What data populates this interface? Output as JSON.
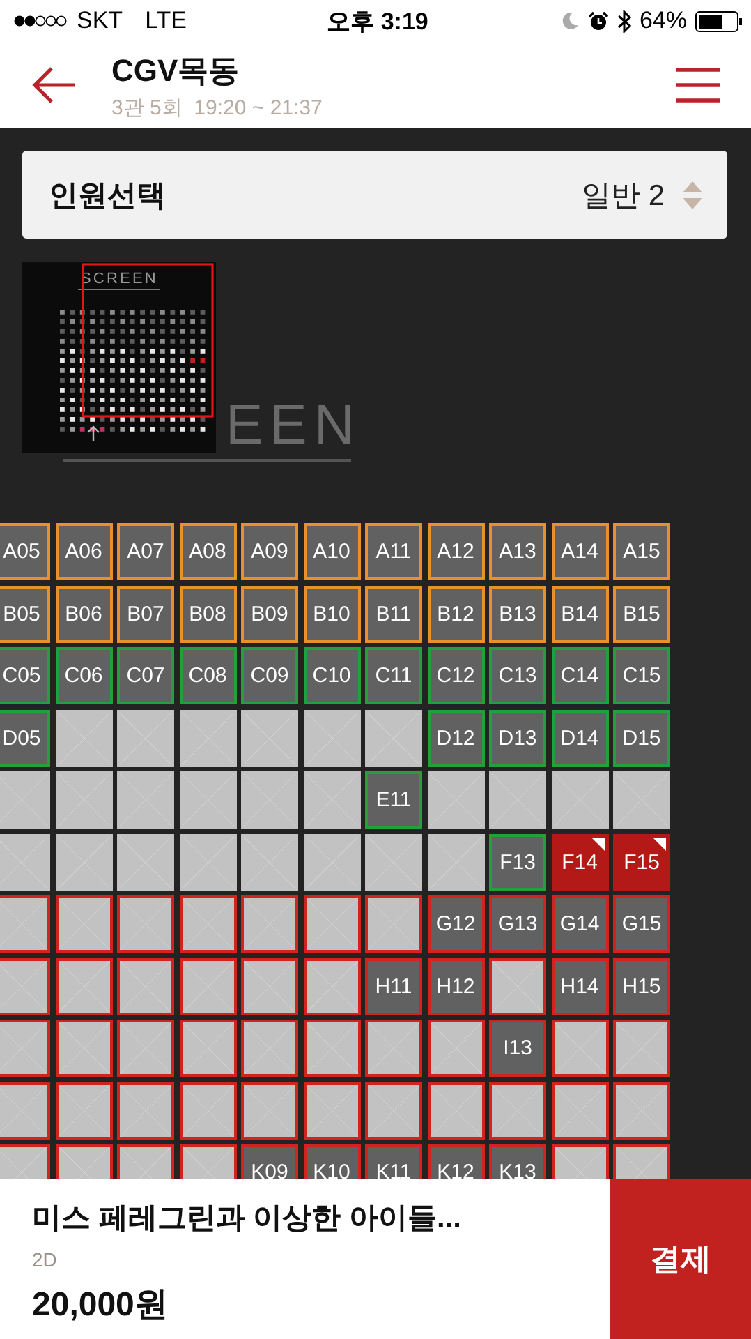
{
  "status_bar": {
    "carrier": "SKT",
    "network": "LTE",
    "time": "오후 3:19",
    "battery": "64%"
  },
  "header": {
    "title": "CGV목동",
    "subtitle": "3관 5회  19:20 ~ 21:37"
  },
  "people_selector": {
    "label": "인원선택",
    "value": "일반 2"
  },
  "screen": {
    "minimap_label": "SCREEN",
    "label": "EEN"
  },
  "seat_rows": [
    {
      "color": "#e8912a",
      "sold_outlined": false,
      "seats": [
        {
          "label": "A05",
          "sold": false,
          "selected": false
        },
        {
          "label": "A06",
          "sold": false,
          "selected": false
        },
        {
          "label": "A07",
          "sold": false,
          "selected": false
        },
        {
          "label": "A08",
          "sold": false,
          "selected": false
        },
        {
          "label": "A09",
          "sold": false,
          "selected": false
        },
        {
          "label": "A10",
          "sold": false,
          "selected": false
        },
        {
          "label": "A11",
          "sold": false,
          "selected": false
        },
        {
          "label": "A12",
          "sold": false,
          "selected": false
        },
        {
          "label": "A13",
          "sold": false,
          "selected": false
        },
        {
          "label": "A14",
          "sold": false,
          "selected": false
        },
        {
          "label": "A15",
          "sold": false,
          "selected": false
        }
      ]
    },
    {
      "color": "#e8912a",
      "sold_outlined": false,
      "seats": [
        {
          "label": "B05",
          "sold": false,
          "selected": false
        },
        {
          "label": "B06",
          "sold": false,
          "selected": false
        },
        {
          "label": "B07",
          "sold": false,
          "selected": false
        },
        {
          "label": "B08",
          "sold": false,
          "selected": false
        },
        {
          "label": "B09",
          "sold": false,
          "selected": false
        },
        {
          "label": "B10",
          "sold": false,
          "selected": false
        },
        {
          "label": "B11",
          "sold": false,
          "selected": false
        },
        {
          "label": "B12",
          "sold": false,
          "selected": false
        },
        {
          "label": "B13",
          "sold": false,
          "selected": false
        },
        {
          "label": "B14",
          "sold": false,
          "selected": false
        },
        {
          "label": "B15",
          "sold": false,
          "selected": false
        }
      ]
    },
    {
      "color": "#22a03c",
      "sold_outlined": false,
      "seats": [
        {
          "label": "C05",
          "sold": false,
          "selected": false
        },
        {
          "label": "C06",
          "sold": false,
          "selected": false
        },
        {
          "label": "C07",
          "sold": false,
          "selected": false
        },
        {
          "label": "C08",
          "sold": false,
          "selected": false
        },
        {
          "label": "C09",
          "sold": false,
          "selected": false
        },
        {
          "label": "C10",
          "sold": false,
          "selected": false
        },
        {
          "label": "C11",
          "sold": false,
          "selected": false
        },
        {
          "label": "C12",
          "sold": false,
          "selected": false
        },
        {
          "label": "C13",
          "sold": false,
          "selected": false
        },
        {
          "label": "C14",
          "sold": false,
          "selected": false
        },
        {
          "label": "C15",
          "sold": false,
          "selected": false
        }
      ]
    },
    {
      "color": "#22a03c",
      "sold_outlined": false,
      "seats": [
        {
          "label": "D05",
          "sold": false,
          "selected": false
        },
        {
          "sold": true
        },
        {
          "sold": true
        },
        {
          "sold": true
        },
        {
          "sold": true
        },
        {
          "sold": true
        },
        {
          "sold": true
        },
        {
          "label": "D12",
          "sold": false,
          "selected": false
        },
        {
          "label": "D13",
          "sold": false,
          "selected": false
        },
        {
          "label": "D14",
          "sold": false,
          "selected": false
        },
        {
          "label": "D15",
          "sold": false,
          "selected": false
        }
      ]
    },
    {
      "color": "#22a03c",
      "sold_outlined": false,
      "seats": [
        {
          "sold": true
        },
        {
          "sold": true
        },
        {
          "sold": true
        },
        {
          "sold": true
        },
        {
          "sold": true
        },
        {
          "sold": true
        },
        {
          "label": "E11",
          "sold": false,
          "selected": false
        },
        {
          "sold": true
        },
        {
          "sold": true
        },
        {
          "sold": true
        },
        {
          "sold": true
        }
      ]
    },
    {
      "color": "#22a03c",
      "sold_outlined": false,
      "seats": [
        {
          "sold": true
        },
        {
          "sold": true
        },
        {
          "sold": true
        },
        {
          "sold": true
        },
        {
          "sold": true
        },
        {
          "sold": true
        },
        {
          "sold": true
        },
        {
          "sold": true
        },
        {
          "label": "F13",
          "sold": false,
          "selected": false
        },
        {
          "label": "F14",
          "sold": false,
          "selected": true
        },
        {
          "label": "F15",
          "sold": false,
          "selected": true
        }
      ]
    },
    {
      "color": "#d2231f",
      "sold_outlined": true,
      "seats": [
        {
          "sold": true
        },
        {
          "sold": true
        },
        {
          "sold": true
        },
        {
          "sold": true
        },
        {
          "sold": true
        },
        {
          "sold": true
        },
        {
          "sold": true
        },
        {
          "label": "G12",
          "sold": false,
          "selected": false
        },
        {
          "label": "G13",
          "sold": false,
          "selected": false
        },
        {
          "label": "G14",
          "sold": false,
          "selected": false
        },
        {
          "label": "G15",
          "sold": false,
          "selected": false
        }
      ]
    },
    {
      "color": "#d2231f",
      "sold_outlined": true,
      "seats": [
        {
          "sold": true
        },
        {
          "sold": true
        },
        {
          "sold": true
        },
        {
          "sold": true
        },
        {
          "sold": true
        },
        {
          "sold": true
        },
        {
          "label": "H11",
          "sold": false,
          "selected": false
        },
        {
          "label": "H12",
          "sold": false,
          "selected": false
        },
        {
          "sold": true
        },
        {
          "label": "H14",
          "sold": false,
          "selected": false
        },
        {
          "label": "H15",
          "sold": false,
          "selected": false
        }
      ]
    },
    {
      "color": "#d2231f",
      "sold_outlined": true,
      "seats": [
        {
          "sold": true
        },
        {
          "sold": true
        },
        {
          "sold": true
        },
        {
          "sold": true
        },
        {
          "sold": true
        },
        {
          "sold": true
        },
        {
          "sold": true
        },
        {
          "sold": true
        },
        {
          "label": "I13",
          "sold": false,
          "selected": false
        },
        {
          "sold": true
        },
        {
          "sold": true
        }
      ]
    },
    {
      "color": "#d2231f",
      "sold_outlined": true,
      "seats": [
        {
          "sold": true
        },
        {
          "sold": true
        },
        {
          "sold": true
        },
        {
          "sold": true
        },
        {
          "sold": true
        },
        {
          "sold": true
        },
        {
          "sold": true
        },
        {
          "sold": true
        },
        {
          "sold": true
        },
        {
          "sold": true
        },
        {
          "sold": true
        }
      ]
    },
    {
      "color": "#d2231f",
      "sold_outlined": true,
      "seats": [
        {
          "sold": true
        },
        {
          "sold": true
        },
        {
          "sold": true
        },
        {
          "sold": true
        },
        {
          "label": "K09",
          "sold": false,
          "selected": false
        },
        {
          "label": "K10",
          "sold": false,
          "selected": false
        },
        {
          "label": "K11",
          "sold": false,
          "selected": false
        },
        {
          "label": "K12",
          "sold": false,
          "selected": false
        },
        {
          "label": "K13",
          "sold": false,
          "selected": false
        },
        {
          "sold": true
        },
        {
          "sold": true
        }
      ]
    }
  ],
  "booking": {
    "movie_title": "미스 페레그린과 이상한 아이들...",
    "format": "2D",
    "price": "20,000원",
    "pay_button": "결제"
  }
}
